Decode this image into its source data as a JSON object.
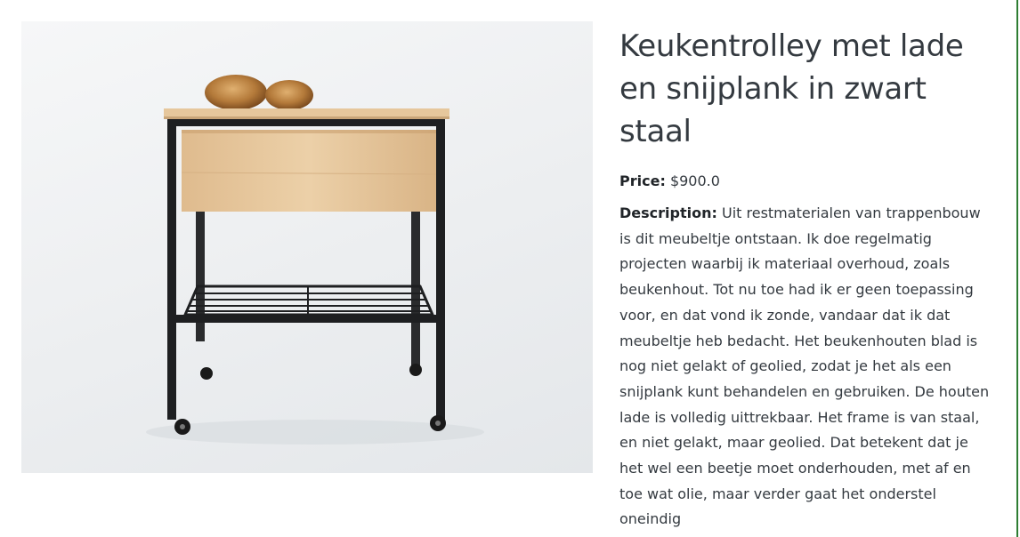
{
  "product": {
    "image_alt": "Keukentrolley met lade en snijplank in zwart staal",
    "title": "Keukentrolley met lade en snijplank in zwart staal",
    "price_label": "Price:",
    "price_value": "$900.0",
    "description_label": "Description:",
    "description_text": "Uit restmaterialen van trappenbouw is dit meubeltje ontstaan. Ik doe regelmatig projecten waarbij ik materiaal overhoud, zoals beukenhout. Tot nu toe had ik er geen toepassing voor, en dat vond ik zonde, vandaar dat ik dat meubeltje heb bedacht. Het beukenhouten blad is nog niet gelakt of geolied, zodat je het als een snijplank kunt behandelen en gebruiken. De houten lade is volledig uittrekbaar. Het frame is van staal, en niet gelakt, maar geolied. Dat betekent dat je het wel een beetje moet onderhouden, met af en toe wat olie, maar verder gaat het onderstel oneindig"
  },
  "colors": {
    "text": "#343a40",
    "accent_border": "#2e7d32",
    "wood": "#e8c9a0",
    "steel": "#1e1f21"
  }
}
